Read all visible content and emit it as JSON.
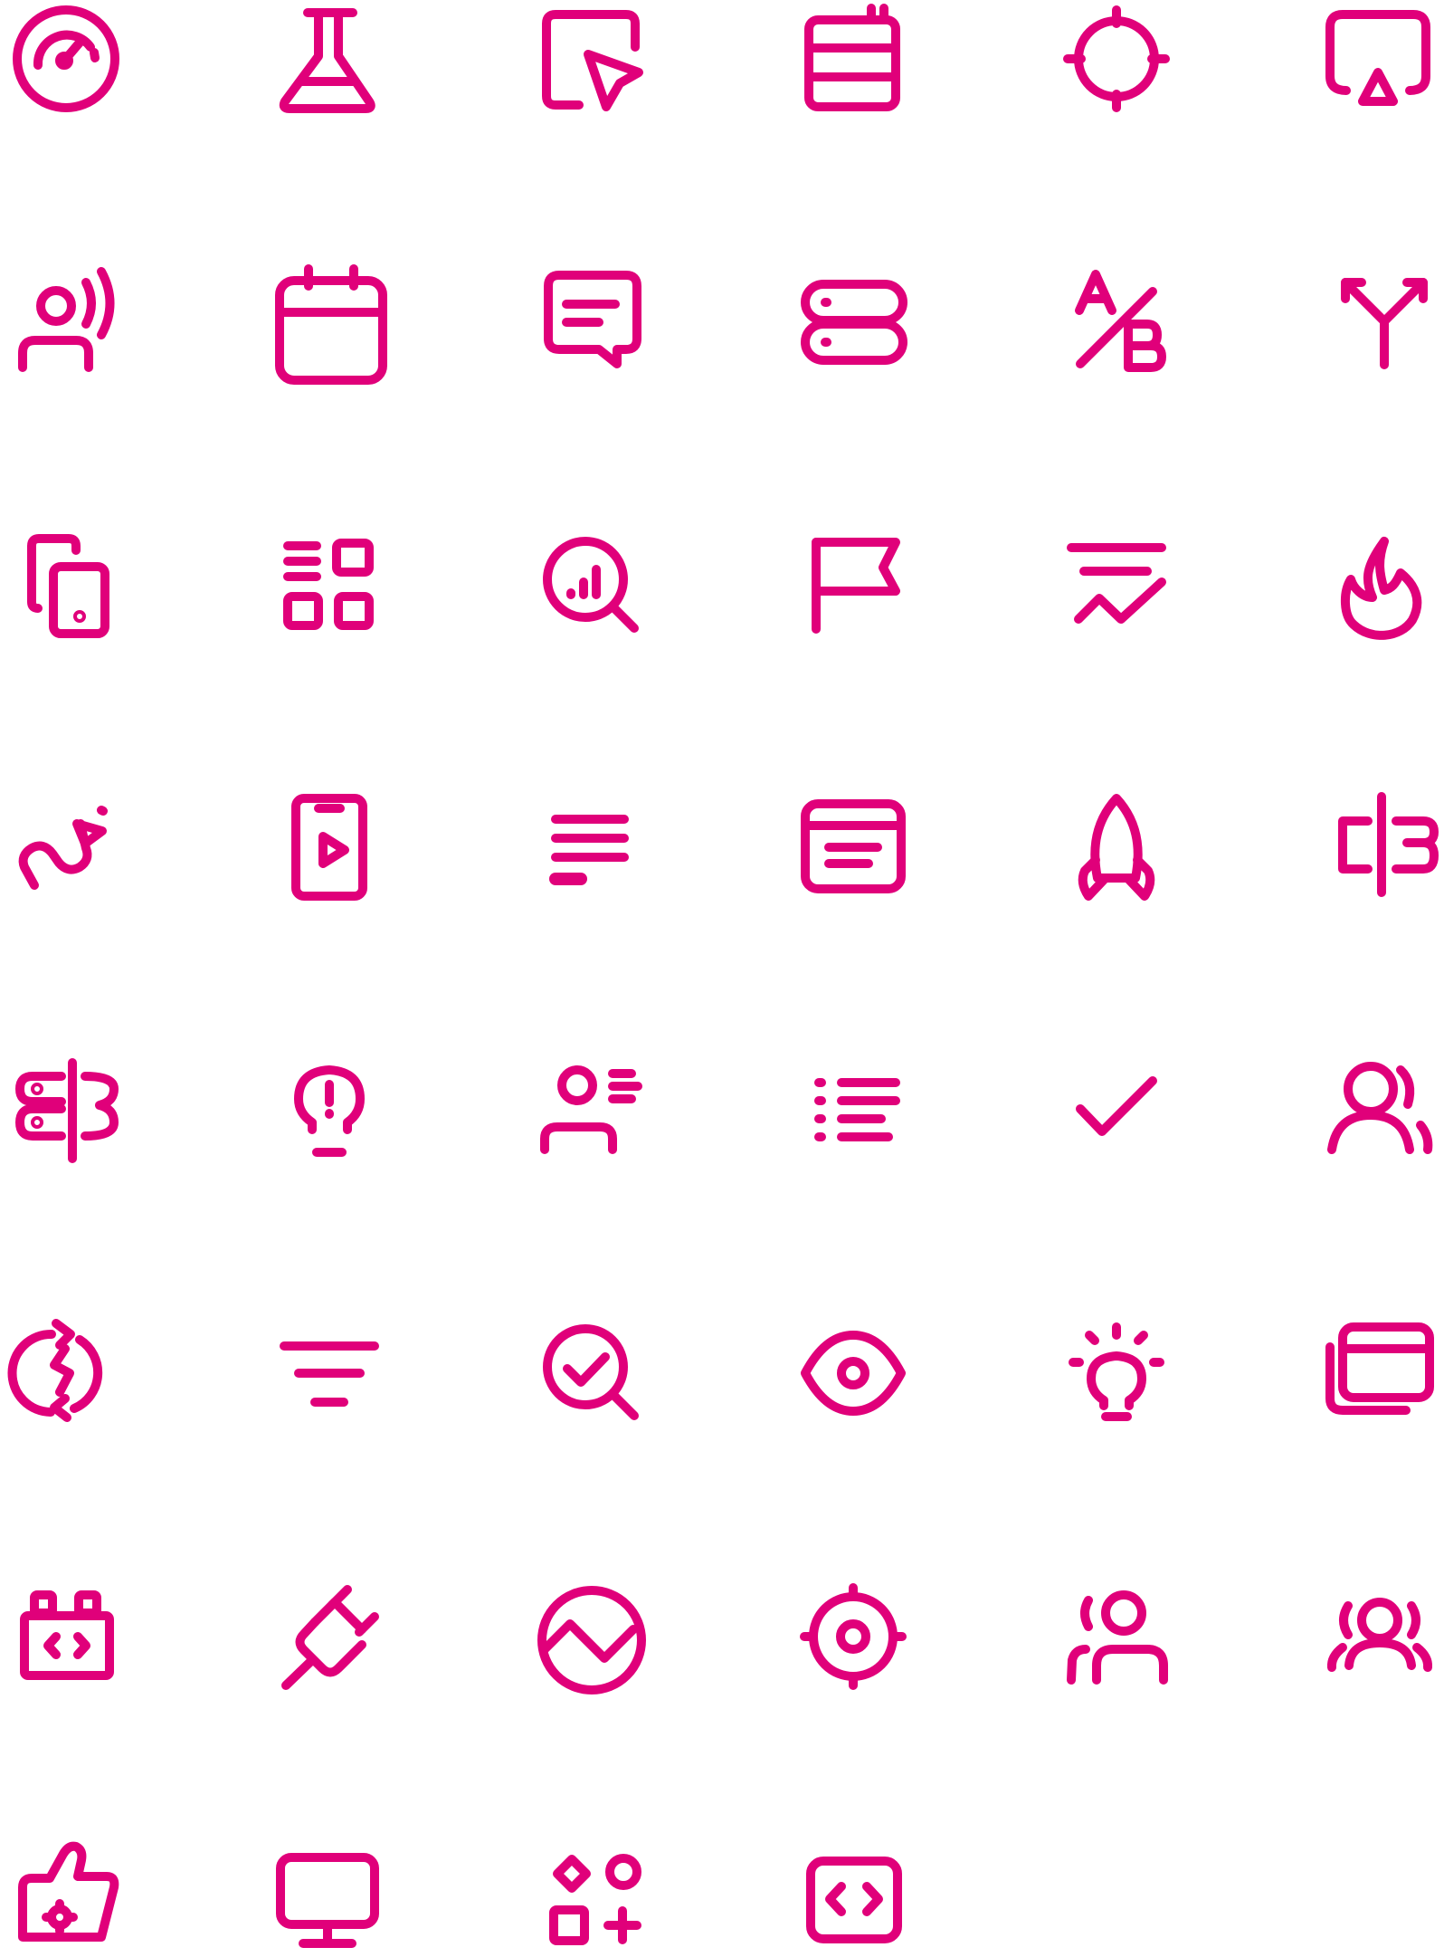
{
  "sheet": {
    "accent_color": "#e0007a",
    "background_color": "#ffffff",
    "icons": [
      [
        "speedometer-icon",
        "lab-flask-icon",
        "cursor-click-icon",
        "database-table-icon",
        "crosshair-icon",
        "airplay-icon"
      ],
      [
        "user-speaking-icon",
        "calendar-icon",
        "chat-message-icon",
        "server-stack-icon",
        "ab-test-icon",
        "split-arrows-icon"
      ],
      [
        "devices-icon",
        "dashboard-grid-icon",
        "search-analytics-icon",
        "flag-icon",
        "trend-filter-icon",
        "flame-icon"
      ],
      [
        "journey-path-icon",
        "mobile-video-icon",
        "text-lines-icon",
        "browser-window-icon",
        "rocket-icon",
        "signpost-icon"
      ],
      [
        "directions-sign-icon",
        "idea-alert-icon",
        "user-list-icon",
        "bullet-list-icon",
        "check-icon",
        "users-icon"
      ],
      [
        "sync-bolt-icon",
        "filter-icon",
        "search-check-icon",
        "eye-icon",
        "lightbulb-icon",
        "windows-stack-icon"
      ],
      [
        "code-battery-icon",
        "plug-icon",
        "chart-circle-icon",
        "target-icon",
        "user-focus-icon",
        "team-icon"
      ],
      [
        "thumbs-up-settings-icon",
        "monitor-icon",
        "add-shapes-icon",
        "code-block-icon"
      ]
    ]
  }
}
